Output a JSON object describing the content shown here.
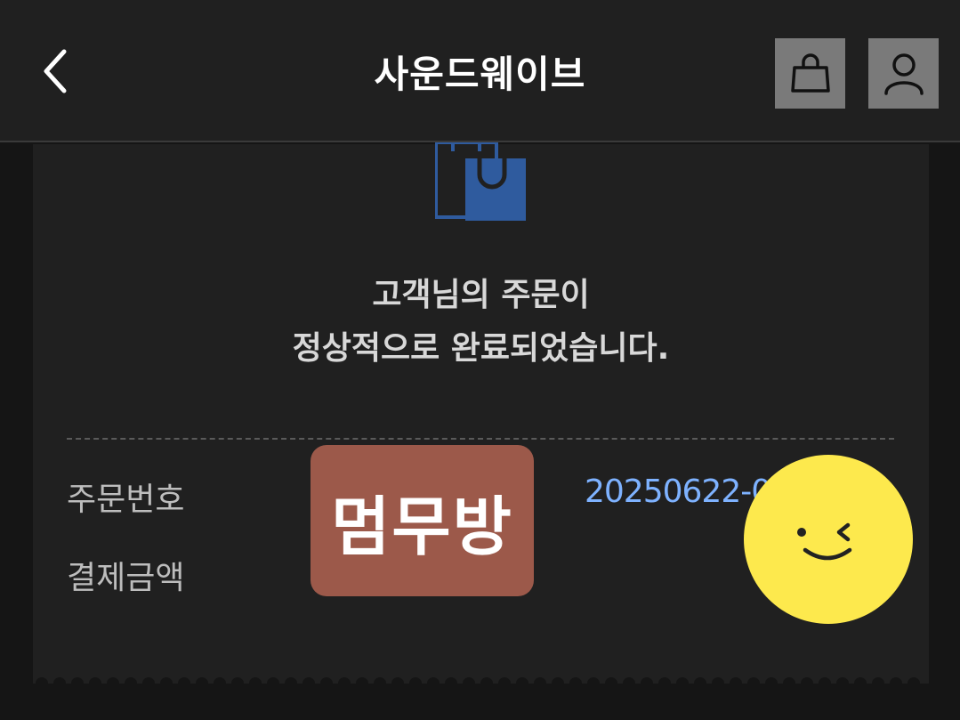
{
  "header": {
    "title": "사운드웨이브",
    "back_icon": "chevron-left-icon",
    "cart_icon": "shopping-bag-icon",
    "user_icon": "user-icon"
  },
  "confirmation": {
    "icon": "shopping-bag-icon",
    "message_line1": "고객님의 주문이",
    "message_line2": "정상적으로 완료되었습니다."
  },
  "order_info": {
    "order_number_label": "주문번호",
    "order_number_value": "20250622-0",
    "payment_label": "결제금액"
  },
  "overlays": {
    "sticker_text": "멈무방",
    "sticker_color": "#9c594a",
    "emoji": "wink-face-icon",
    "emoji_color": "#fde94d"
  },
  "colors": {
    "accent": "#7eb2ff",
    "bag_icon": "#2f5b9e"
  }
}
